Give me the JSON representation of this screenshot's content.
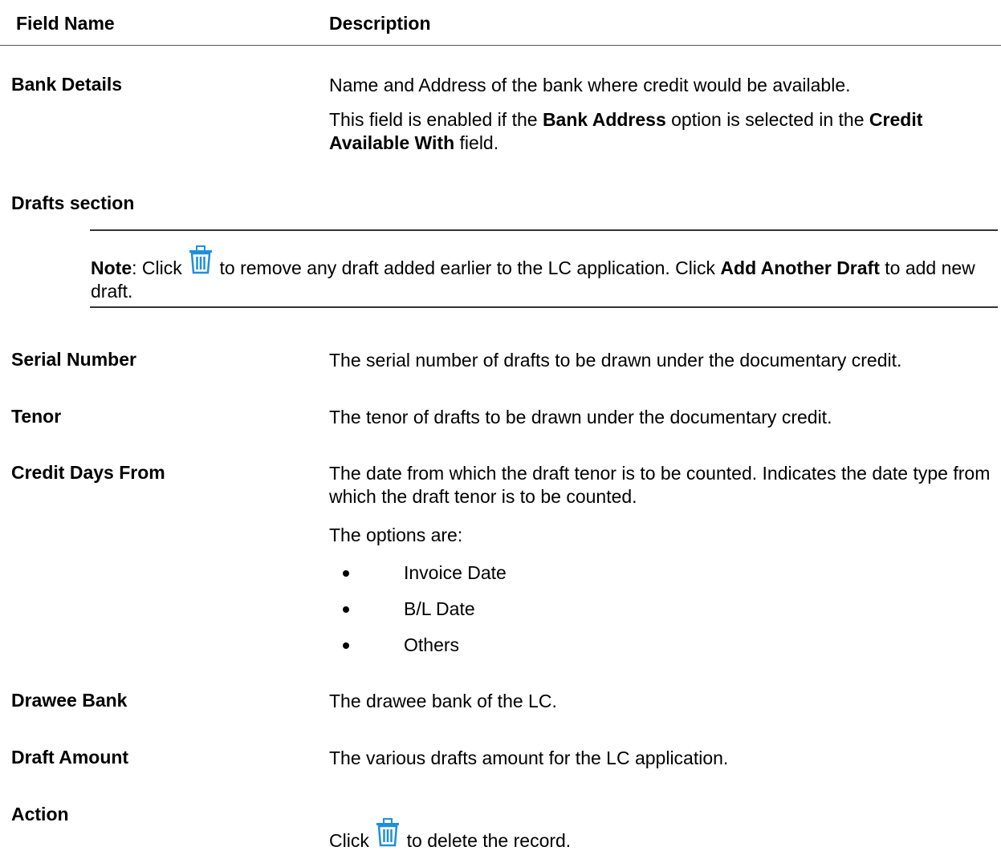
{
  "header": {
    "field_name": "Field Name",
    "description": "Description"
  },
  "bank_details": {
    "label": "Bank Details",
    "desc1": "Name and Address of the bank where credit would be available.",
    "desc2_a": "This field is enabled if the ",
    "desc2_b": "Bank Address",
    "desc2_c": " option is selected in the ",
    "desc2_d": "Credit Available With",
    "desc2_e": " field."
  },
  "drafts_section": {
    "title": "Drafts section"
  },
  "note": {
    "label": "Note",
    "text_a": ": Click ",
    "text_b": " to remove any draft added earlier to the LC application. Click ",
    "text_c": "Add Another Draft",
    "text_d": " to add new draft.",
    "icon": "trash-icon"
  },
  "rows": {
    "serial_number": {
      "label": "Serial Number",
      "desc": "The serial number of drafts to be drawn under the documentary credit."
    },
    "tenor": {
      "label": "Tenor",
      "desc": "The tenor of drafts to be drawn under the documentary credit."
    },
    "credit_days_from": {
      "label": "Credit Days From",
      "desc": "The date from which the draft tenor is to be counted. Indicates the date type from which the draft tenor is to be counted.",
      "options_intro": "The options are:",
      "options": [
        "Invoice Date",
        "B/L Date",
        "Others"
      ]
    },
    "drawee_bank": {
      "label": "Drawee Bank",
      "desc": "The drawee bank of the LC."
    },
    "draft_amount": {
      "label": "Draft Amount",
      "desc": "The various drafts amount for the LC application."
    },
    "action": {
      "label": "Action",
      "desc_a": "Click ",
      "desc_b": " to delete the record.",
      "icon": "trash-icon"
    }
  },
  "colors": {
    "icon_blue": "#1f8fd8",
    "rule": "#333333"
  }
}
